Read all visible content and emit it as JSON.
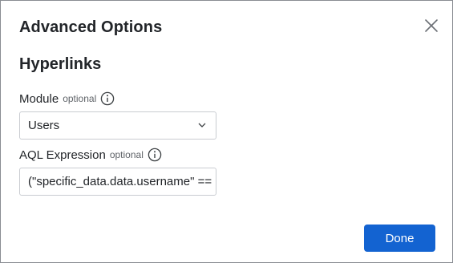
{
  "dialog": {
    "title": "Advanced Options",
    "close_icon": "close-icon",
    "section_title": "Hyperlinks",
    "module": {
      "label": "Module",
      "optional": "optional",
      "info_icon": "info-icon",
      "value": "Users",
      "chevron_icon": "chevron-down-icon"
    },
    "aql": {
      "label": "AQL Expression",
      "optional": "optional",
      "info_icon": "info-icon",
      "value": "(\"specific_data.data.username\" =="
    },
    "done_label": "Done",
    "accent_color": "#1363d1"
  }
}
